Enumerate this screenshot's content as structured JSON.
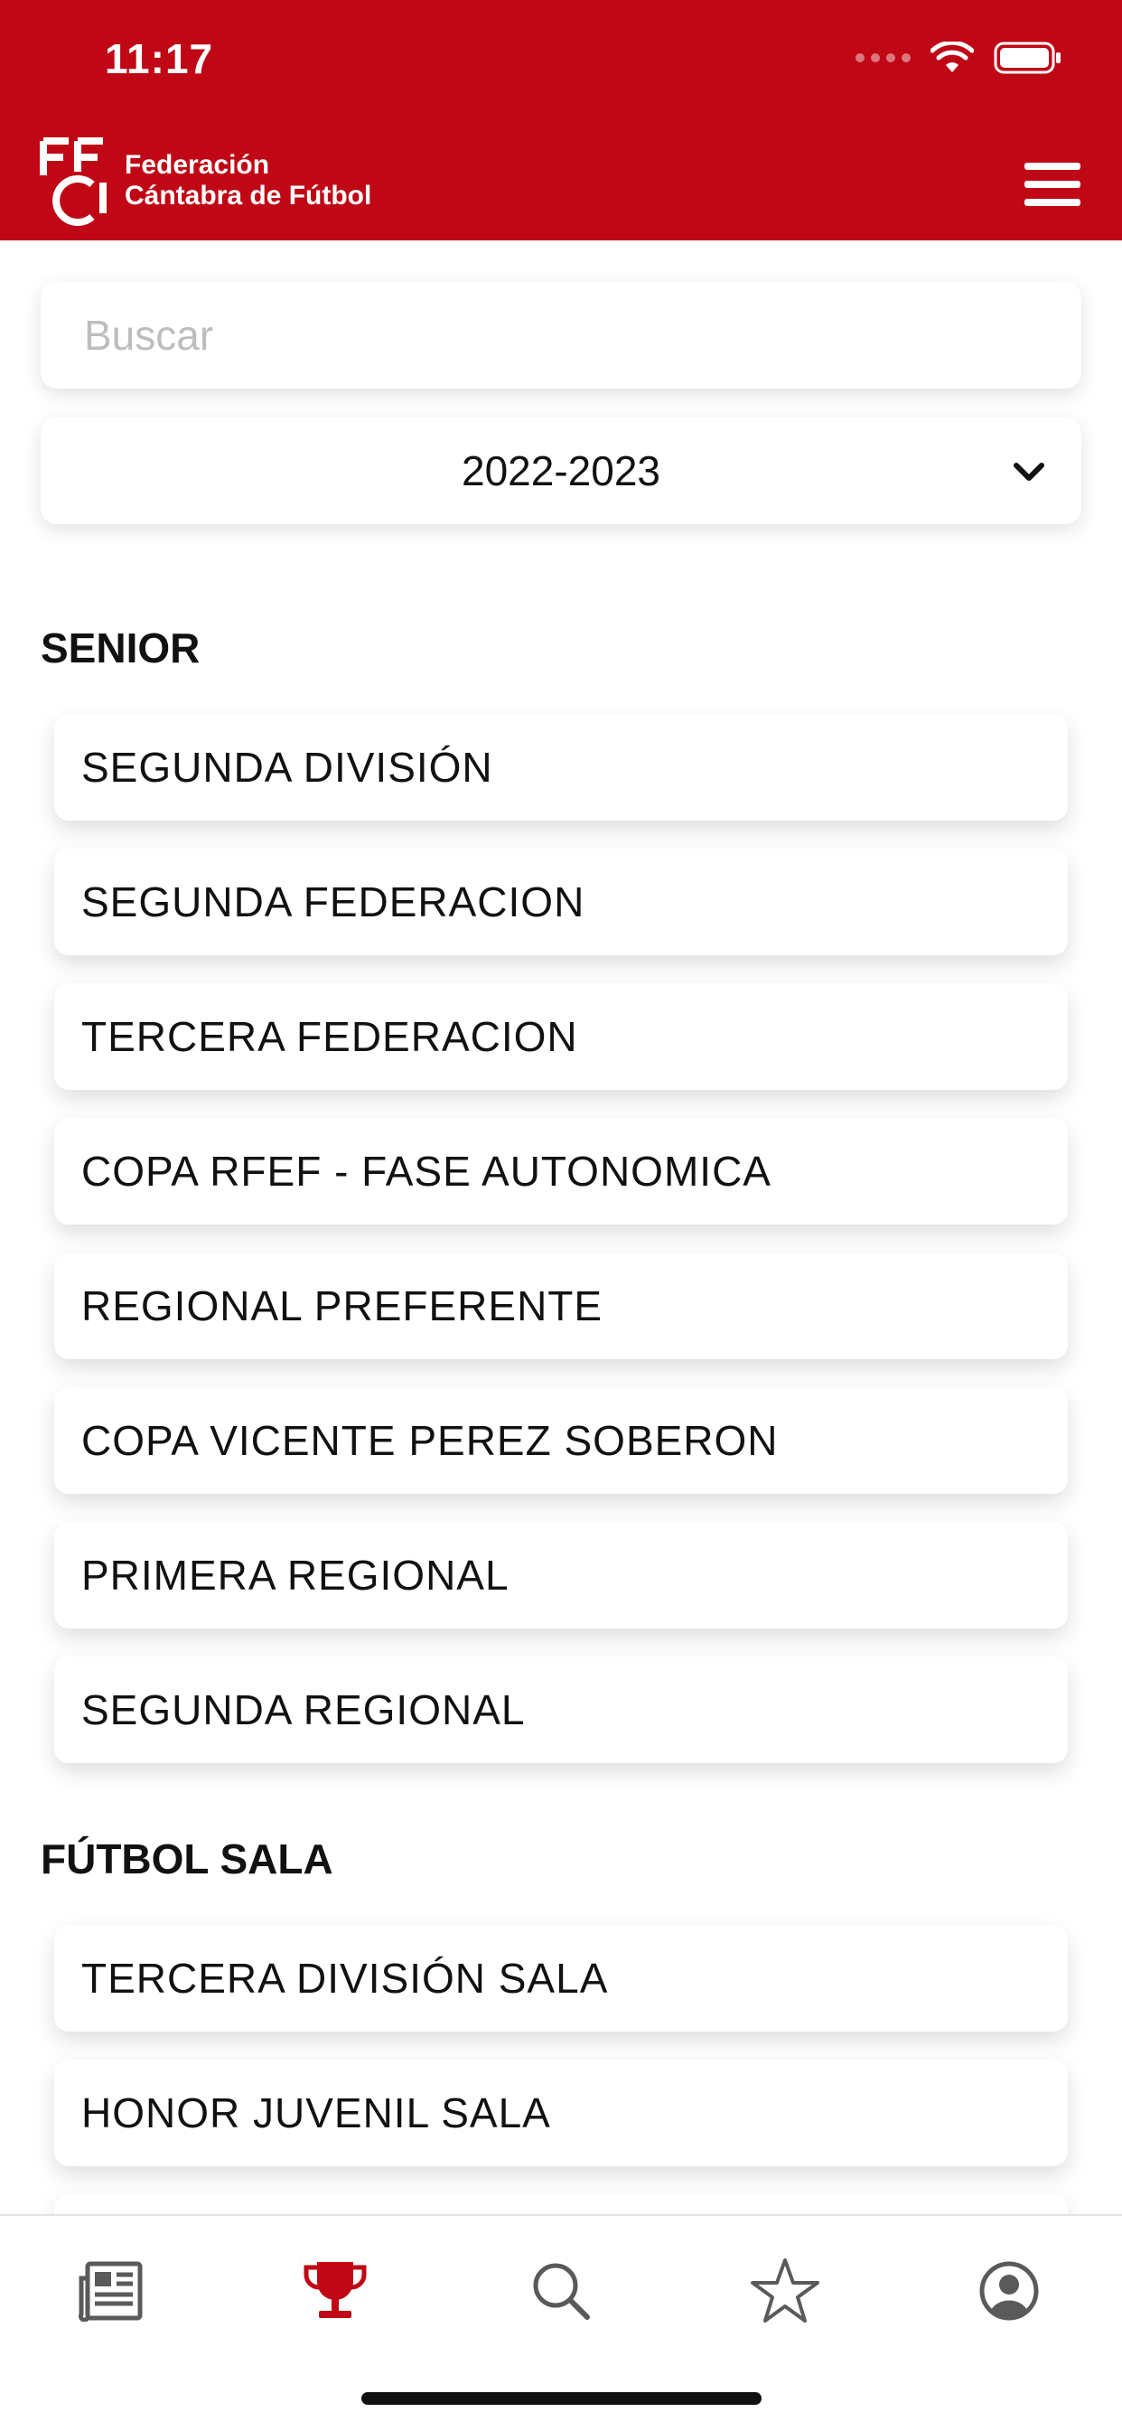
{
  "status": {
    "time": "11:17"
  },
  "header": {
    "logo_line1": "Federación",
    "logo_line2": "Cántabra de Fútbol"
  },
  "search": {
    "placeholder": "Buscar",
    "value": ""
  },
  "season": {
    "selected": "2022-2023"
  },
  "sections": [
    {
      "title": "SENIOR",
      "items": [
        "SEGUNDA DIVISIÓN",
        "SEGUNDA FEDERACION",
        "TERCERA FEDERACION",
        "COPA RFEF - FASE AUTONOMICA",
        "REGIONAL PREFERENTE",
        "COPA VICENTE PEREZ SOBERON",
        "PRIMERA REGIONAL",
        "SEGUNDA REGIONAL"
      ]
    },
    {
      "title": "FÚTBOL SALA",
      "items": [
        "TERCERA DIVISIÓN SALA",
        "HONOR JUVENIL SALA",
        ""
      ]
    }
  ],
  "tabbar": {
    "tabs": [
      "news-icon",
      "trophy-icon",
      "search-icon",
      "star-icon",
      "profile-icon"
    ],
    "active": "trophy-icon"
  },
  "colors": {
    "brand": "#c00715",
    "inactive_icon": "#5a5a5a"
  }
}
